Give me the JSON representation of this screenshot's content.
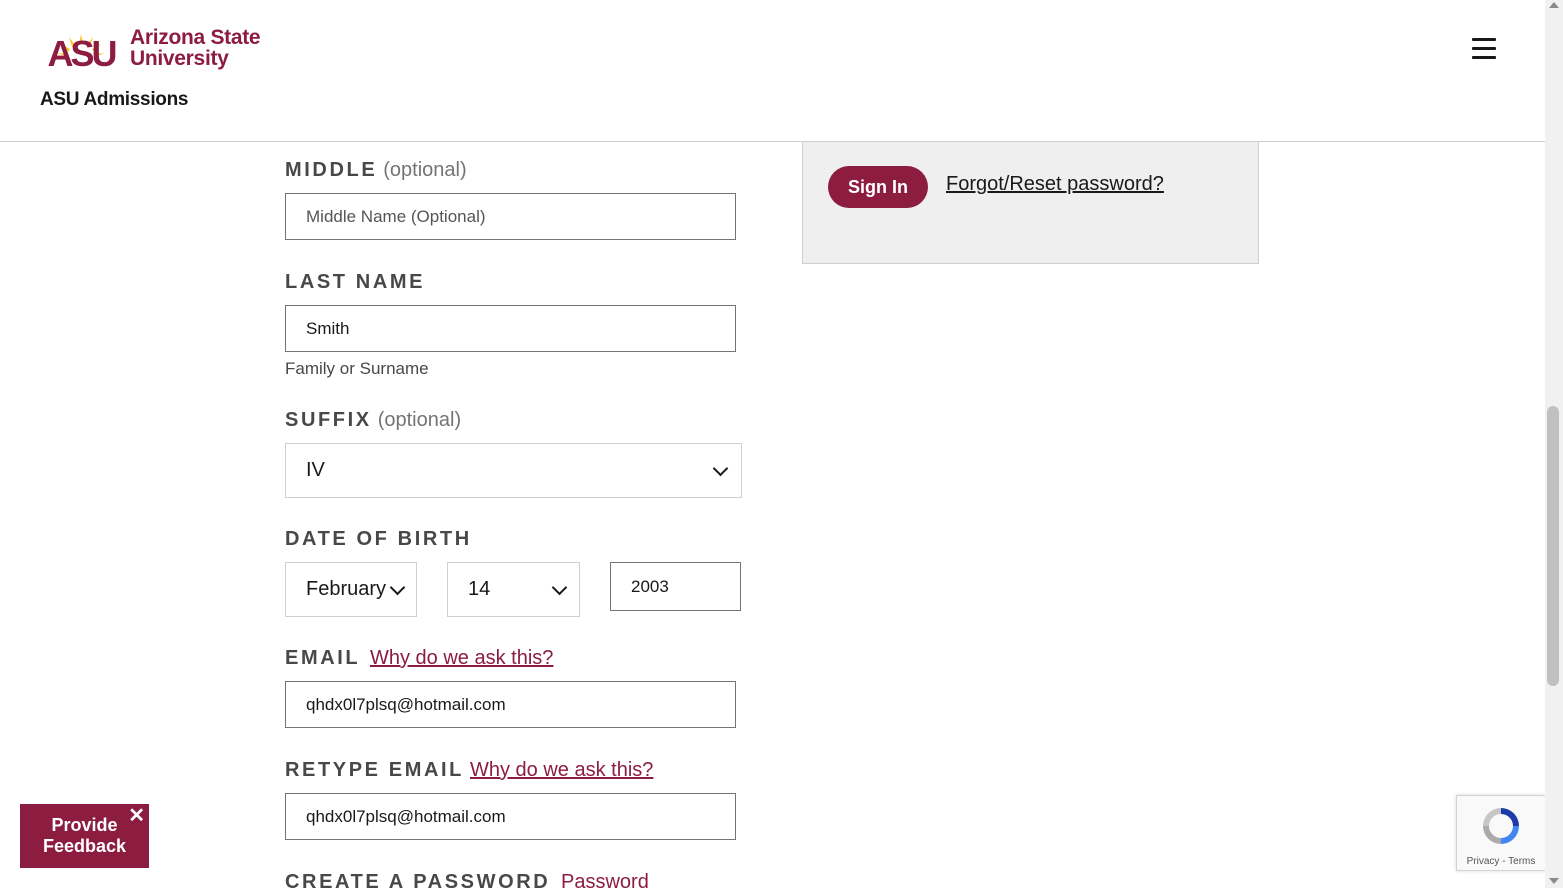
{
  "header": {
    "logo_mark": "ASU",
    "logo_line1": "Arizona State",
    "logo_line2": "University",
    "site_title": "ASU Admissions"
  },
  "form": {
    "middle": {
      "label": "MIDDLE",
      "optional": "(optional)",
      "placeholder": "Middle Name (Optional)",
      "value": ""
    },
    "last_name": {
      "label": "LAST NAME",
      "value": "Smith",
      "hint": "Family or Surname"
    },
    "suffix": {
      "label": "SUFFIX",
      "optional": "(optional)",
      "selected": "IV"
    },
    "dob": {
      "label": "DATE OF BIRTH",
      "month": "February",
      "day": "14",
      "year": "2003"
    },
    "email": {
      "label": "EMAIL",
      "why": "Why do we ask this?",
      "value": "qhdx0l7plsq@hotmail.com"
    },
    "retype_email": {
      "label": "RETYPE EMAIL",
      "why": "Why do we ask this?",
      "value": "qhdx0l7plsq@hotmail.com"
    },
    "password": {
      "label": "CREATE A PASSWORD",
      "link": "Password"
    }
  },
  "signin": {
    "button": "Sign In",
    "forgot": "Forgot/Reset password?"
  },
  "feedback": {
    "label": "Provide Feedback",
    "close": "✕"
  },
  "recaptcha": {
    "footer": "Privacy - Terms"
  },
  "colors": {
    "maroon": "#8c1d40",
    "gold": "#ffc627"
  }
}
